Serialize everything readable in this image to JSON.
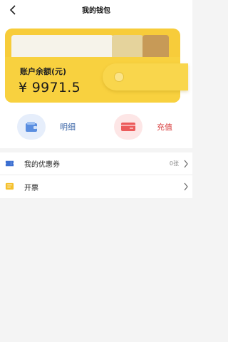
{
  "header": {
    "title": "我的钱包"
  },
  "wallet": {
    "balance_label": "账户余额(元)",
    "balance_value": "¥ 9971.5"
  },
  "actions": [
    {
      "label": "明细",
      "icon": "wallet-icon"
    },
    {
      "label": "充值",
      "icon": "card-icon"
    }
  ],
  "list": {
    "items": [
      {
        "label": "我的优惠券",
        "value": "0张",
        "icon": "ticket-icon"
      },
      {
        "label": "开票",
        "value": "",
        "icon": "invoice-icon"
      }
    ]
  },
  "colors": {
    "wallet": "#f7cc3a",
    "detail": "#3a64a6",
    "recharge": "#d94141"
  }
}
